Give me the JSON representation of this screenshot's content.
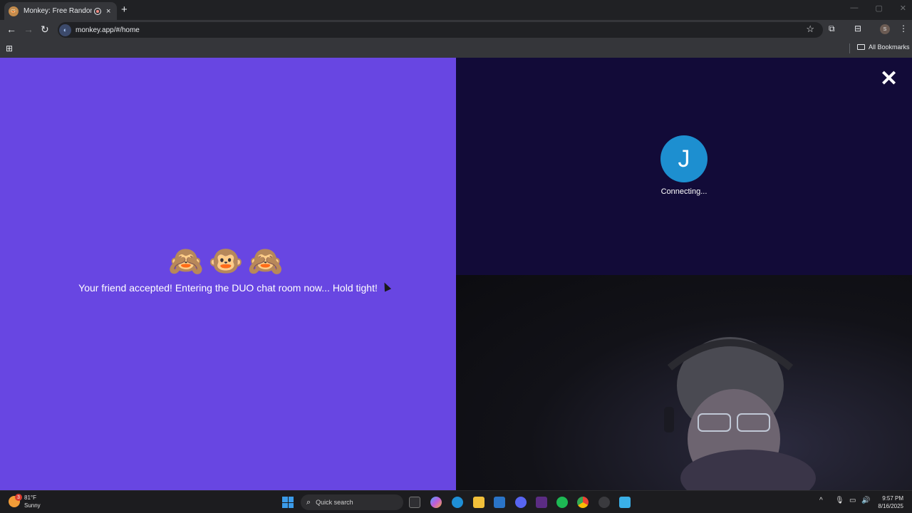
{
  "browser": {
    "tab_title": "Monkey: Free Random Vide",
    "tab_close": "×",
    "new_tab": "+",
    "url": "monkey.app/#/home",
    "bookmarks_label": "All Bookmarks",
    "profile_initial": "S",
    "win_min": "—",
    "win_max": "▢",
    "win_close": "✕"
  },
  "left_panel": {
    "emojis": "🙈🐵🙈",
    "message": "Your friend accepted! Entering the DUO chat room now... Hold tight!",
    "background": "#6846e2"
  },
  "right_panel": {
    "close_label": "✕",
    "avatar_initial": "J",
    "status": "Connecting...",
    "background": "#120b38",
    "avatar_color": "#1d8fd0"
  },
  "taskbar": {
    "weather_badge": "3",
    "temperature": "81°F",
    "condition": "Sunny",
    "search_placeholder": "Quick search",
    "time": "9:57 PM",
    "date": "8/16/2025"
  }
}
